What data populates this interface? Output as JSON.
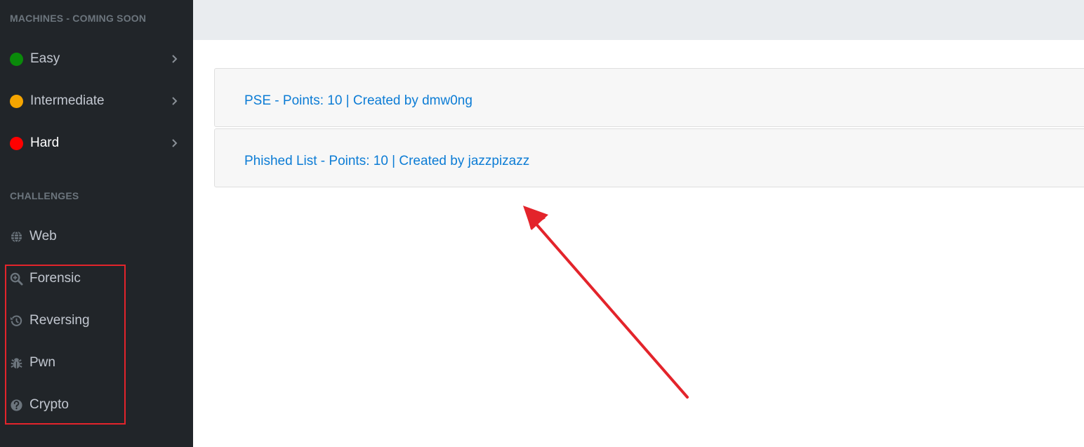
{
  "sidebar": {
    "machines_header": "MACHINES - COMING SOON",
    "machines": [
      {
        "label": "Easy",
        "color": "#0a8a0a"
      },
      {
        "label": "Intermediate",
        "color": "#f5a500"
      },
      {
        "label": "Hard",
        "color": "#ff0000"
      }
    ],
    "challenges_header": "CHALLENGES",
    "challenges": [
      {
        "label": "Web",
        "icon": "globe-icon"
      },
      {
        "label": "Forensic",
        "icon": "search-plus-icon"
      },
      {
        "label": "Reversing",
        "icon": "history-icon"
      },
      {
        "label": "Pwn",
        "icon": "bug-icon"
      },
      {
        "label": "Crypto",
        "icon": "question-circle-icon"
      }
    ]
  },
  "main": {
    "challenges": [
      {
        "title": "PSE - Points: 10 | Created by dmw0ng"
      },
      {
        "title": "Phished List - Points: 10 | Created by jazzpizazz"
      }
    ]
  },
  "colors": {
    "sidebar_bg": "#212529",
    "topbar_bg": "#e9ecef",
    "link": "#0c7cd5",
    "annotation": "#e3242b"
  }
}
